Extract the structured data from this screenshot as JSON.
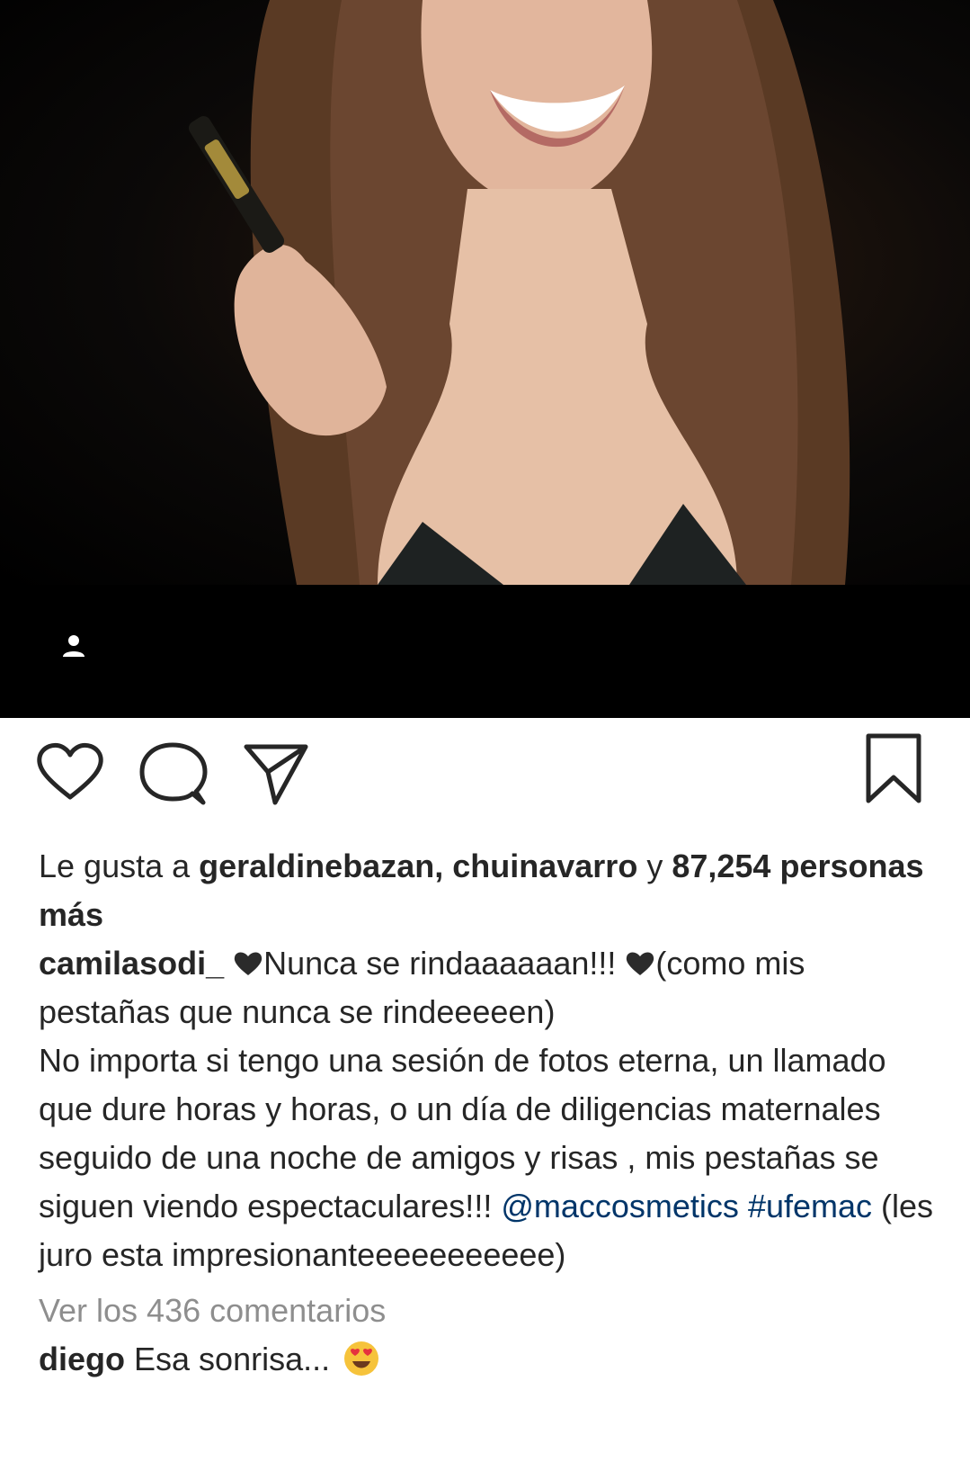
{
  "post": {
    "photo_description_icon": "person-tag-icon"
  },
  "actions": {
    "like_icon": "heart-outline-icon",
    "comment_icon": "comment-bubble-icon",
    "share_icon": "paper-plane-icon",
    "save_icon": "bookmark-icon"
  },
  "likes": {
    "prefix": "Le gusta a ",
    "user1": "geraldinebazan",
    "sep": ", ",
    "user2": "chuinavarro",
    "and": " y ",
    "count_text": "87,254 personas más"
  },
  "caption": {
    "username": "camilasodi_",
    "line1_text": "Nunca se rindaaaaaan!!! ",
    "line1_tail": "(como mis pestañas que nunca se rindeeeeen)",
    "body": "No importa si tengo una sesión de fotos eterna, un llamado que dure horas y horas, o un día de diligencias maternales seguido de una noche de amigos y risas , mis pestañas se siguen viendo espectaculares!!! ",
    "mention": "@maccosmetics",
    "hashtag": "#ufemac",
    "end": " (les juro esta impresionanteeeeeeeeeee)"
  },
  "comments": {
    "view_all": "Ver los 436 comentarios",
    "items": [
      {
        "username": "diego",
        "text": "Esa sonrisa... "
      }
    ]
  },
  "colors": {
    "text": "#262626",
    "link": "#003569",
    "muted": "#8e8e8e"
  }
}
